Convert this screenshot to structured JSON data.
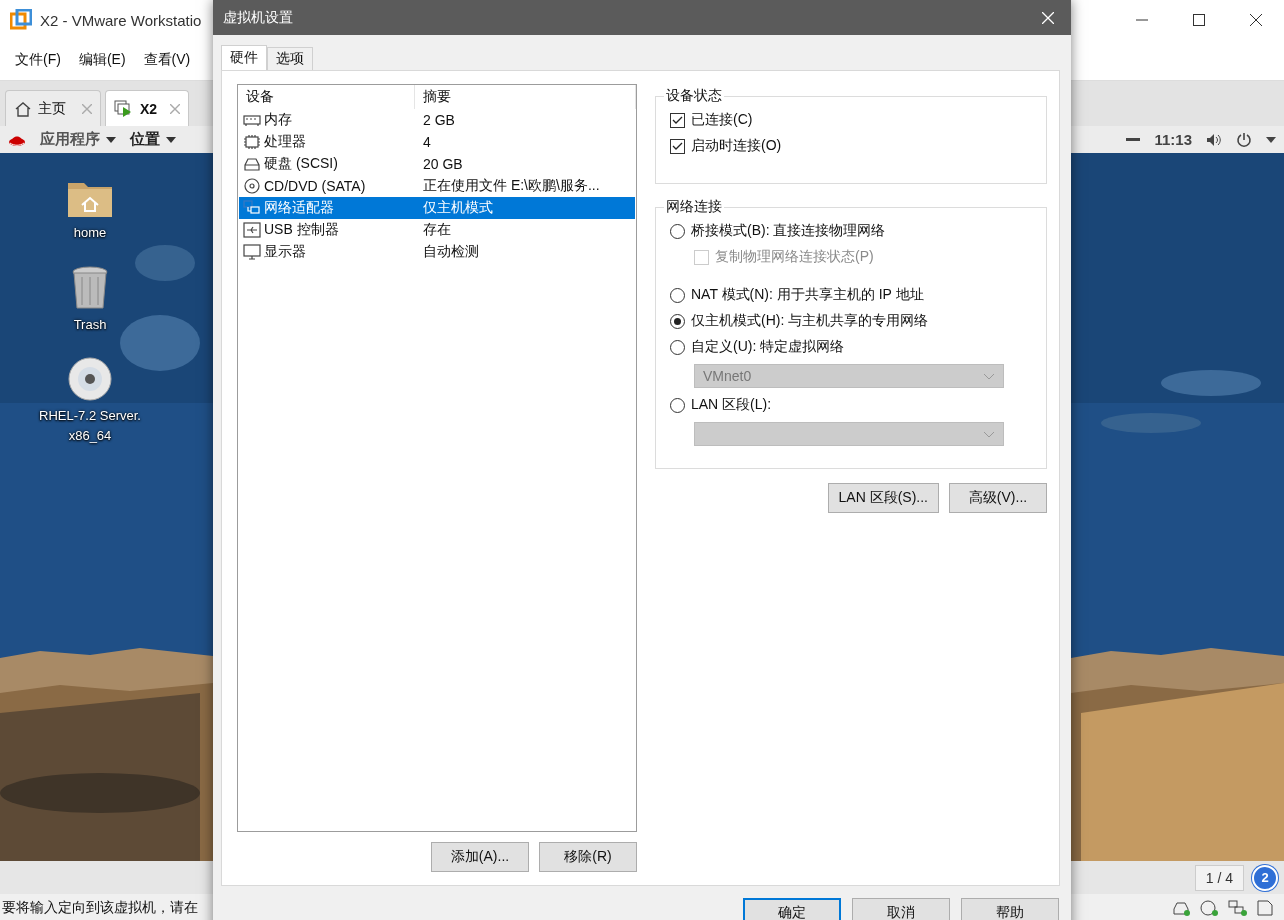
{
  "window": {
    "title": "X2 - VMware Workstatio"
  },
  "menu": [
    "文件(F)",
    "编辑(E)",
    "查看(V)"
  ],
  "tabs": [
    {
      "label": "主页",
      "selected": false,
      "kind": "home"
    },
    {
      "label": "X2",
      "selected": true,
      "kind": "vm"
    }
  ],
  "guest_panel": {
    "menus": [
      "应用程序",
      "位置"
    ],
    "clock": "11:13"
  },
  "desktop_icons": [
    {
      "label": "home",
      "kind": "folder"
    },
    {
      "label": "Trash",
      "kind": "trash"
    },
    {
      "label": "RHEL-7.2 Server. x86_64",
      "kind": "disc"
    }
  ],
  "page_indicator": "1 / 4",
  "badge": "2",
  "status_text": "要将输入定向到该虚拟机，请在",
  "dialog": {
    "title": "虚拟机设置",
    "tabs": [
      {
        "label": "硬件",
        "selected": true
      },
      {
        "label": "选项",
        "selected": false
      }
    ],
    "columns": [
      "设备",
      "摘要"
    ],
    "devices": [
      {
        "name": "内存",
        "summary": "2 GB",
        "kind": "memory",
        "selected": false
      },
      {
        "name": "处理器",
        "summary": "4",
        "kind": "cpu",
        "selected": false
      },
      {
        "name": "硬盘 (SCSI)",
        "summary": "20 GB",
        "kind": "disk",
        "selected": false
      },
      {
        "name": "CD/DVD (SATA)",
        "summary": "正在使用文件 E:\\欧鹏\\服务...",
        "kind": "cd",
        "selected": false
      },
      {
        "name": "网络适配器",
        "summary": "仅主机模式",
        "kind": "network",
        "selected": true
      },
      {
        "name": "USB 控制器",
        "summary": "存在",
        "kind": "usb",
        "selected": false
      },
      {
        "name": "显示器",
        "summary": "自动检测",
        "kind": "display",
        "selected": false
      }
    ],
    "list_buttons": [
      "添加(A)...",
      "移除(R)"
    ],
    "device_status": {
      "title": "设备状态",
      "options": [
        {
          "label": "已连接(C)",
          "checked": true
        },
        {
          "label": "启动时连接(O)",
          "checked": true
        }
      ]
    },
    "network": {
      "title": "网络连接",
      "options": [
        {
          "kind": "radio",
          "label": "桥接模式(B): 直接连接物理网络",
          "selected": false
        },
        {
          "kind": "checkbox",
          "label": "复制物理网络连接状态(P)",
          "checked": false,
          "disabled": true
        },
        {
          "kind": "radio",
          "label": "NAT 模式(N): 用于共享主机的 IP 地址",
          "selected": false
        },
        {
          "kind": "radio",
          "label": "仅主机模式(H): 与主机共享的专用网络",
          "selected": true
        },
        {
          "kind": "radio",
          "label": "自定义(U): 特定虚拟网络",
          "selected": false
        },
        {
          "kind": "select",
          "value": "VMnet0",
          "disabled": true
        },
        {
          "kind": "radio",
          "label": "LAN 区段(L):",
          "selected": false
        },
        {
          "kind": "select",
          "disabled": true
        }
      ]
    },
    "network_buttons": [
      "LAN 区段(S)...",
      "高级(V)..."
    ],
    "footer_buttons": [
      {
        "label": "确定",
        "default": true
      },
      {
        "label": "取消",
        "default": false
      },
      {
        "label": "帮助",
        "default": false
      }
    ]
  }
}
